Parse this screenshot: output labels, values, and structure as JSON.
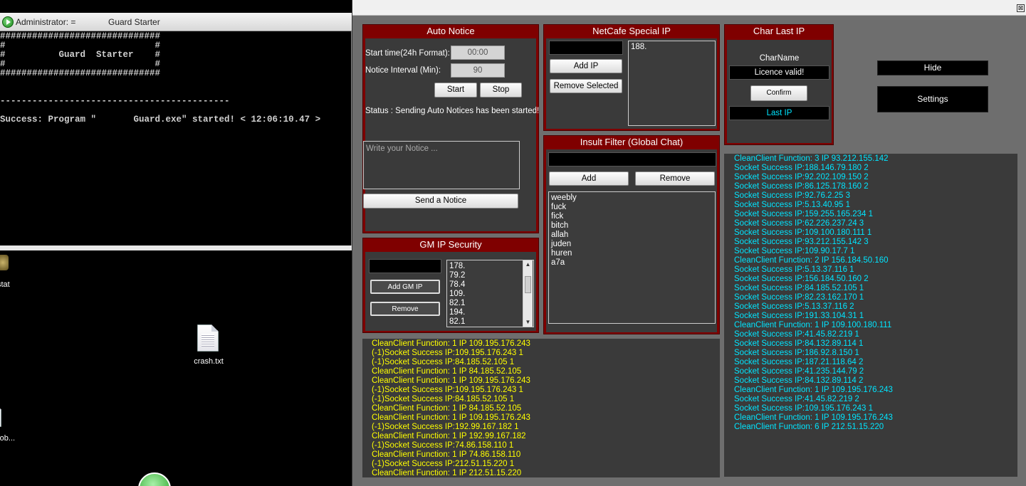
{
  "console": {
    "title_a": "Administrator: =",
    "title_b": "Guard Starter",
    "lines": [
      "##############################",
      "#                            #",
      "#          Guard  Starter    #",
      "#                            #",
      "##############################",
      "",
      "",
      "-------------------------------------------",
      "",
      "Success: Program \"       Guard.exe\" started! < 12:06:10.47 >"
    ]
  },
  "desktop": {
    "icons": [
      {
        "label": "stat"
      },
      {
        "label": "crash.txt"
      },
      {
        "label": "rob..."
      }
    ]
  },
  "guard": {
    "close_label": "⊠",
    "auto_notice": {
      "title": "Auto Notice",
      "start_time_label": "Start time(24h Format):",
      "start_time_value": "00:00",
      "interval_label": "Notice Interval (Min):",
      "interval_value": "90",
      "start_button": "Start",
      "stop_button": "Stop",
      "status": "Status : Sending Auto Notices has been started!",
      "notice_placeholder": "Write your Notice ...",
      "send_button": "Send a Notice"
    },
    "netcafe": {
      "title": "NetCafe Special IP",
      "add_button": "Add IP",
      "remove_button": "Remove Selected",
      "list": [
        "188."
      ]
    },
    "char_last_ip": {
      "title": "Char Last IP",
      "charname_label": "CharName",
      "charname_value": "Licence valid!",
      "confirm_button": "Confirm",
      "last_ip": "Last IP"
    },
    "hide_button": "Hide",
    "settings_button": "Settings",
    "insult_filter": {
      "title": "Insult Filter (Global Chat)",
      "add_button": "Add",
      "remove_button": "Remove",
      "words": [
        "weebly",
        "fuck",
        "fick",
        "bitch",
        "allah",
        "juden",
        "huren",
        "a7a"
      ]
    },
    "gm_ip": {
      "title": "GM IP Security",
      "add_button": "Add GM IP",
      "remove_button": "Remove",
      "list": [
        "178.",
        "79.2",
        "78.4",
        "109.",
        "82.1",
        "194.",
        "82.1"
      ]
    },
    "log_left": [
      "CleanClient Function: 1 IP 109.195.176.243",
      "(-1)Socket Success IP:109.195.176.243 1",
      "(-1)Socket Success IP:84.185.52.105 1",
      "CleanClient Function: 1 IP 84.185.52.105",
      "CleanClient Function: 1 IP 109.195.176.243",
      "(-1)Socket Success IP:109.195.176.243 1",
      "(-1)Socket Success IP:84.185.52.105 1",
      "CleanClient Function: 1 IP 84.185.52.105",
      "CleanClient Function: 1 IP 109.195.176.243",
      "(-1)Socket Success IP:192.99.167.182 1",
      "CleanClient Function: 1 IP 192.99.167.182",
      "(-1)Socket Success IP:74.86.158.110 1",
      "CleanClient Function: 1 IP 74.86.158.110",
      "(-1)Socket Success IP:212.51.15.220 1",
      "CleanClient Function: 1 IP 212.51.15.220"
    ],
    "log_right": [
      "CleanClient Function: 3 IP 93.212.155.142",
      "Socket Success IP:188.146.79.180 2",
      "Socket Success IP:92.202.109.150 2",
      "Socket Success IP:86.125.178.160 2",
      "Socket Success IP:92.76.2.25 3",
      "Socket Success IP:5.13.40.95 1",
      "Socket Success IP:159.255.165.234 1",
      "Socket Success IP:62.226.237.24 3",
      "Socket Success IP:109.100.180.111 1",
      "Socket Success IP:93.212.155.142 3",
      "Socket Success IP:109.90.17.7 1",
      "CleanClient Function: 2 IP 156.184.50.160",
      "Socket Success IP:5.13.37.116 1",
      "Socket Success IP:156.184.50.160 2",
      "Socket Success IP:84.185.52.105 1",
      "Socket Success IP:82.23.162.170 1",
      "Socket Success IP:5.13.37.116 2",
      "Socket Success IP:191.33.104.31 1",
      "CleanClient Function: 1 IP 109.100.180.111",
      "Socket Success IP:41.45.82.219 1",
      "Socket Success IP:84.132.89.114 1",
      "Socket Success IP:186.92.8.150 1",
      "Socket Success IP:187.21.118.64 2",
      "Socket Success IP:41.235.144.79 2",
      "Socket Success IP:84.132.89.114 2",
      "CleanClient Function: 1 IP 109.195.176.243",
      "Socket Success IP:41.45.82.219 2",
      "Socket Success IP:109.195.176.243 1",
      "CleanClient Function: 1 IP 109.195.176.243",
      "CleanClient Function: 6 IP 212.51.15.220"
    ]
  }
}
